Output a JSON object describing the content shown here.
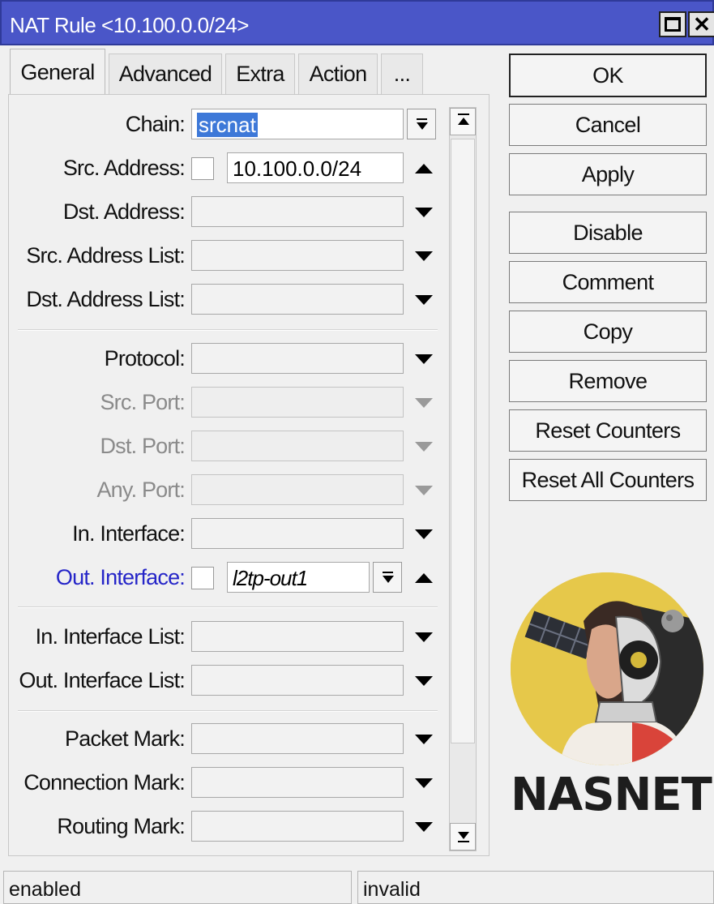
{
  "window": {
    "title": "NAT Rule <10.100.0.0/24>"
  },
  "tabs": [
    {
      "label": "General",
      "active": true
    },
    {
      "label": "Advanced"
    },
    {
      "label": "Extra"
    },
    {
      "label": "Action"
    },
    {
      "label": "..."
    }
  ],
  "fields": {
    "chain": {
      "label": "Chain:",
      "value": "srcnat"
    },
    "src_address": {
      "label": "Src. Address:",
      "value": "10.100.0.0/24"
    },
    "dst_address": {
      "label": "Dst. Address:",
      "value": ""
    },
    "src_address_list": {
      "label": "Src. Address List:",
      "value": ""
    },
    "dst_address_list": {
      "label": "Dst. Address List:",
      "value": ""
    },
    "protocol": {
      "label": "Protocol:",
      "value": ""
    },
    "src_port": {
      "label": "Src. Port:",
      "value": ""
    },
    "dst_port": {
      "label": "Dst. Port:",
      "value": ""
    },
    "any_port": {
      "label": "Any. Port:",
      "value": ""
    },
    "in_interface": {
      "label": "In. Interface:",
      "value": ""
    },
    "out_interface": {
      "label": "Out. Interface:",
      "value": "l2tp-out1"
    },
    "in_interface_list": {
      "label": "In. Interface List:",
      "value": ""
    },
    "out_interface_list": {
      "label": "Out. Interface List:",
      "value": ""
    },
    "packet_mark": {
      "label": "Packet Mark:",
      "value": ""
    },
    "connection_mark": {
      "label": "Connection Mark:",
      "value": ""
    },
    "routing_mark": {
      "label": "Routing Mark:",
      "value": ""
    }
  },
  "buttons": {
    "ok": "OK",
    "cancel": "Cancel",
    "apply": "Apply",
    "disable": "Disable",
    "comment": "Comment",
    "copy": "Copy",
    "remove": "Remove",
    "reset_counters": "Reset Counters",
    "reset_all_counters": "Reset All Counters"
  },
  "status": {
    "left": "enabled",
    "right": "invalid"
  },
  "logo": {
    "text": "NASNET"
  },
  "colors": {
    "titlebar": "#4a56c8",
    "selection": "#3d78d8",
    "link_label": "#2525c8",
    "logo_circle": "#e6c84a"
  }
}
